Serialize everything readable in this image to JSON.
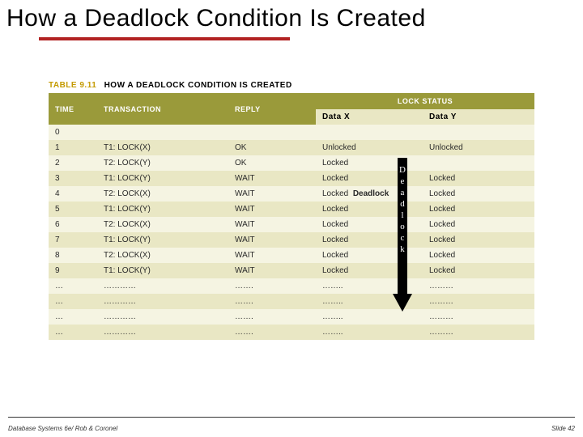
{
  "slide": {
    "title": "How a Deadlock Condition Is Created",
    "footer_left": "Database Systems 6e/ Rob & Coronel",
    "footer_right": "Slide 42"
  },
  "table": {
    "caption_num": "TABLE 9.11",
    "caption_text": "HOW A DEADLOCK CONDITION IS CREATED",
    "headers": {
      "time": "TIME",
      "transaction": "TRANSACTION",
      "reply": "REPLY",
      "lock_status": "LOCK STATUS",
      "data_x": "Data X",
      "data_y": "Data Y"
    },
    "rows": [
      {
        "time": "0",
        "transaction": "",
        "reply": "",
        "x": "",
        "y": ""
      },
      {
        "time": "1",
        "transaction": "T1: LOCK(X)",
        "reply": "OK",
        "x": "Unlocked",
        "y": "Unlocked"
      },
      {
        "time": "2",
        "transaction": "T2: LOCK(Y)",
        "reply": "OK",
        "x": "Locked",
        "y": ""
      },
      {
        "time": "3",
        "transaction": "T1: LOCK(Y)",
        "reply": "WAIT",
        "x": "Locked",
        "y": "Locked"
      },
      {
        "time": "4",
        "transaction": "T2: LOCK(X)",
        "reply": "WAIT",
        "x": "Locked",
        "xbold": true,
        "deadlock": "Deadlock",
        "y": "Locked"
      },
      {
        "time": "5",
        "transaction": "T1: LOCK(Y)",
        "reply": "WAIT",
        "x": "Locked",
        "y": "Locked"
      },
      {
        "time": "6",
        "transaction": "T2: LOCK(X)",
        "reply": "WAIT",
        "x": "Locked",
        "y": "Locked"
      },
      {
        "time": "7",
        "transaction": "T1: LOCK(Y)",
        "reply": "WAIT",
        "x": "Locked",
        "y": "Locked"
      },
      {
        "time": "8",
        "transaction": "T2: LOCK(X)",
        "reply": "WAIT",
        "x": "Locked",
        "y": "Locked"
      },
      {
        "time": "9",
        "transaction": "T1: LOCK(Y)",
        "reply": "WAIT",
        "x": "Locked",
        "y": "Locked"
      },
      {
        "time": "…",
        "transaction": "…………",
        "reply": "…….",
        "x": "……..",
        "y": "………"
      },
      {
        "time": "…",
        "transaction": "…………",
        "reply": "…….",
        "x": "……..",
        "y": "………"
      },
      {
        "time": "…",
        "transaction": "…………",
        "reply": "…….",
        "x": "……..",
        "y": "………"
      },
      {
        "time": "…",
        "transaction": "…………",
        "reply": "…….",
        "x": "……..",
        "y": "………"
      }
    ]
  },
  "arrow_label": "Deadlock",
  "chart_data": {
    "type": "table",
    "title": "How a Deadlock Condition Is Created",
    "columns": [
      "TIME",
      "TRANSACTION",
      "REPLY",
      "LOCK STATUS Data X",
      "LOCK STATUS Data Y"
    ],
    "rows": [
      [
        "0",
        "",
        "",
        "",
        ""
      ],
      [
        "1",
        "T1: LOCK(X)",
        "OK",
        "Unlocked",
        "Unlocked"
      ],
      [
        "2",
        "T2: LOCK(Y)",
        "OK",
        "Locked",
        ""
      ],
      [
        "3",
        "T1: LOCK(Y)",
        "WAIT",
        "Locked",
        "Locked"
      ],
      [
        "4",
        "T2: LOCK(X)",
        "WAIT",
        "Locked (Deadlock)",
        "Locked"
      ],
      [
        "5",
        "T1: LOCK(Y)",
        "WAIT",
        "Locked",
        "Locked"
      ],
      [
        "6",
        "T2: LOCK(X)",
        "WAIT",
        "Locked",
        "Locked"
      ],
      [
        "7",
        "T1: LOCK(Y)",
        "WAIT",
        "Locked",
        "Locked"
      ],
      [
        "8",
        "T2: LOCK(X)",
        "WAIT",
        "Locked",
        "Locked"
      ],
      [
        "9",
        "T1: LOCK(Y)",
        "WAIT",
        "Locked",
        "Locked"
      ],
      [
        "…",
        "…",
        "…",
        "…",
        "…"
      ],
      [
        "…",
        "…",
        "…",
        "…",
        "…"
      ],
      [
        "…",
        "…",
        "…",
        "…",
        "…"
      ],
      [
        "…",
        "…",
        "…",
        "…",
        "…"
      ]
    ]
  }
}
